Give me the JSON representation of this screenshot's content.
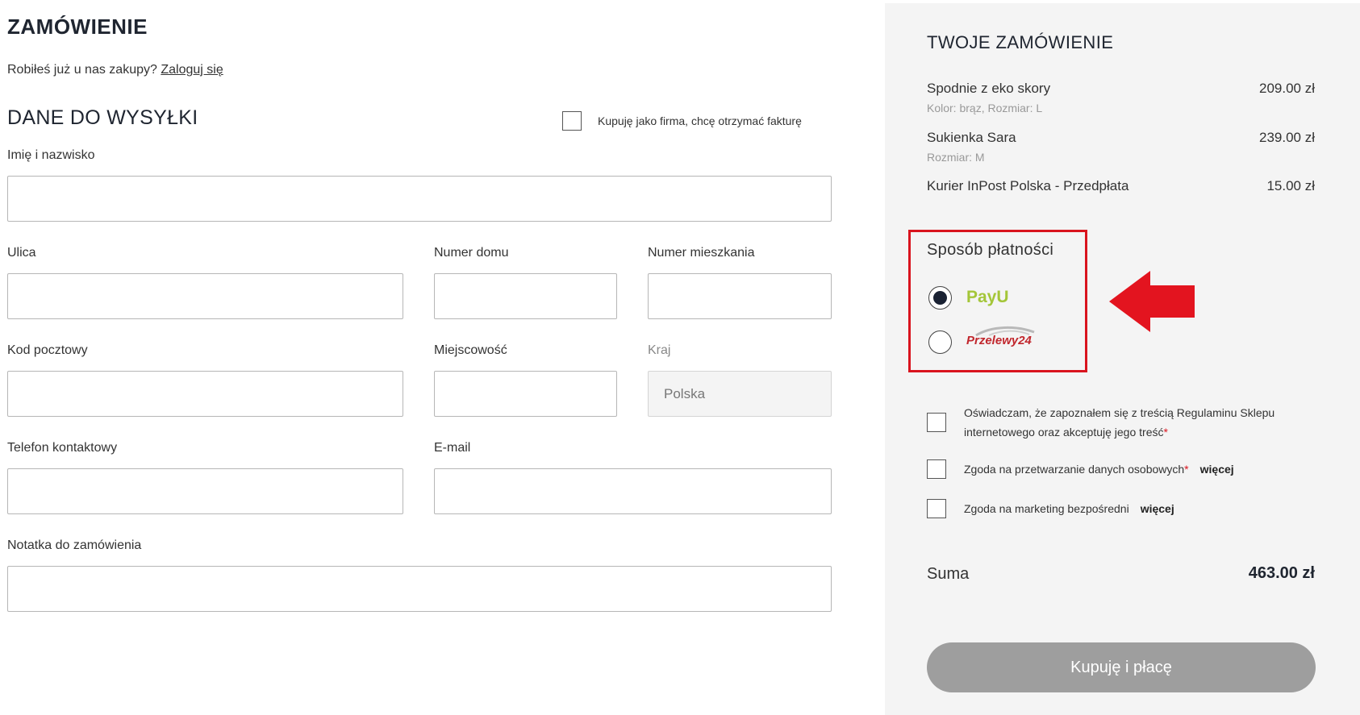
{
  "page": {
    "title": "ZAMÓWIENIE",
    "login_prompt": "Robiłeś już u nas zakupy?",
    "login_link": "Zaloguj się"
  },
  "shipping": {
    "title": "DANE DO WYSYŁKI",
    "company_checkbox_label": "Kupuję jako firma, chcę otrzymać fakturę",
    "fields": {
      "name": {
        "label": "Imię i nazwisko",
        "value": ""
      },
      "street": {
        "label": "Ulica",
        "value": ""
      },
      "house_no": {
        "label": "Numer domu",
        "value": ""
      },
      "apartment_no": {
        "label": "Numer mieszkania",
        "value": ""
      },
      "postal_code": {
        "label": "Kod pocztowy",
        "value": ""
      },
      "city": {
        "label": "Miejscowość",
        "value": ""
      },
      "country": {
        "label": "Kraj",
        "value": "Polska"
      },
      "phone": {
        "label": "Telefon kontaktowy",
        "value": ""
      },
      "email": {
        "label": "E-mail",
        "value": ""
      },
      "note": {
        "label": "Notatka do zamówienia",
        "value": ""
      }
    }
  },
  "order": {
    "title": "TWOJE ZAMÓWIENIE",
    "items": [
      {
        "name": "Spodnie z eko skory",
        "details": "Kolor: brąz, Rozmiar: L",
        "price": "209.00 zł"
      },
      {
        "name": "Sukienka Sara",
        "details": "Rozmiar: M",
        "price": "239.00 zł"
      },
      {
        "name": "Kurier InPost Polska - Przedpłata",
        "details": "",
        "price": "15.00 zł"
      }
    ],
    "payment": {
      "title": "Sposób płatności",
      "options": [
        {
          "name": "PayU",
          "selected": true
        },
        {
          "name": "Przelewy24",
          "selected": false
        }
      ]
    },
    "consents": [
      {
        "text": "Oświadczam, że zapoznałem się z treścią Regulaminu Sklepu internetowego oraz akceptuję jego treść",
        "required": "*",
        "more": ""
      },
      {
        "text": "Zgoda na przetwarzanie danych osobowych",
        "required": "*",
        "more": "więcej"
      },
      {
        "text": "Zgoda na marketing bezpośredni",
        "required": "",
        "more": "więcej"
      }
    ],
    "total_label": "Suma",
    "total_value": "463.00 zł",
    "submit_label": "Kupuję i płacę"
  },
  "colors": {
    "highlight_border": "#d9141e",
    "arrow": "#e3141f",
    "payu_green": "#a4c639",
    "p24_red": "#c1272d",
    "button_bg": "#9e9e9e",
    "panel_bg": "#f4f4f4"
  }
}
